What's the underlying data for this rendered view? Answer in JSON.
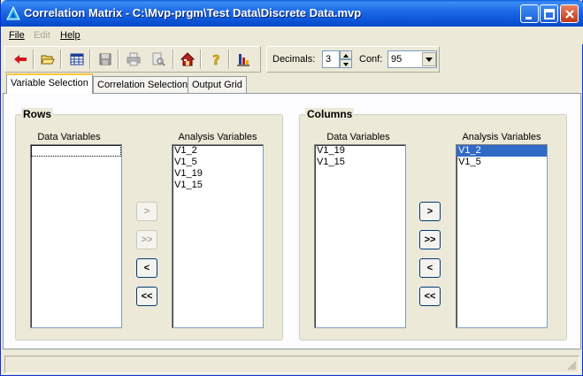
{
  "window": {
    "title": "Correlation Matrix - C:\\Mvp-prgm\\Test Data\\Discrete Data.mvp"
  },
  "menu": {
    "file": "File",
    "edit": "Edit",
    "help": "Help"
  },
  "toolbar": {
    "icons": [
      "back-arrow-icon",
      "open-folder-icon",
      "grid-icon",
      "save-icon",
      "print-icon",
      "print-preview-icon",
      "home-icon",
      "help-icon",
      "chart-icon"
    ]
  },
  "options": {
    "decimals_label": "Decimals:",
    "decimals_value": "3",
    "conf_label": "Conf:",
    "conf_value": "95"
  },
  "tabs": [
    {
      "label": "Variable Selection",
      "active": true
    },
    {
      "label": "Correlation Selection",
      "active": false
    },
    {
      "label": "Output Grid",
      "active": false
    }
  ],
  "rows": {
    "title": "Rows",
    "data_label": "Data Variables",
    "analysis_label": "Analysis Variables",
    "data_items": [],
    "analysis_items": [
      "V1_2",
      "V1_5",
      "V1_19",
      "V1_15"
    ],
    "buttons": [
      ">",
      ">>",
      "<",
      "<<"
    ]
  },
  "columns": {
    "title": "Columns",
    "data_label": "Data Variables",
    "analysis_label": "Analysis Variables",
    "data_items": [
      "V1_19",
      "V1_15"
    ],
    "analysis_items": [
      "V1_2",
      "V1_5"
    ],
    "selected_analysis": "V1_2",
    "buttons": [
      ">",
      ">>",
      "<",
      "<<"
    ]
  },
  "colors": {
    "titlebar": "#0A5EDC",
    "selection": "#316AC5",
    "tab_highlight": "#FFC83C"
  }
}
